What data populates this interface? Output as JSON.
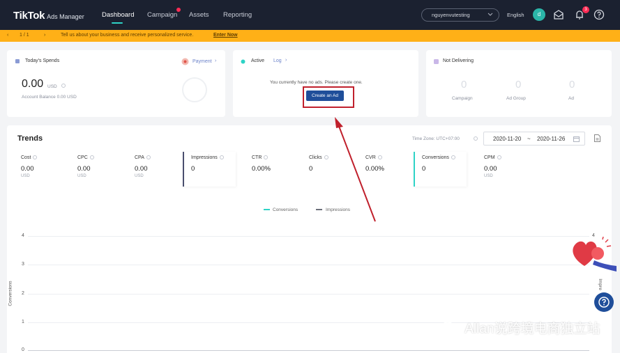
{
  "nav": {
    "logo": "TikTok",
    "logo_suffix": "Ads Manager",
    "items": [
      "Dashboard",
      "Campaign",
      "Assets",
      "Reporting"
    ],
    "account": "nguyenvutesting",
    "language": "English",
    "avatar_letter": "d",
    "notification_count": "3"
  },
  "banner": {
    "pager": "1 / 1",
    "text": "Tell us about your business and receive personalized service.",
    "link": "Enter Now"
  },
  "spends": {
    "title": "Today's Spends",
    "payment_label": "Payment",
    "amount": "0.00",
    "currency": "USD",
    "balance": "Account Balance 0.00 USD"
  },
  "active": {
    "title": "Active",
    "log_label": "Log",
    "message": "You currently have no ads. Please create one.",
    "create_button": "Create an Ad"
  },
  "not_delivering": {
    "title": "Not Delivering",
    "items": [
      {
        "value": "0",
        "label": "Campaign"
      },
      {
        "value": "0",
        "label": "Ad Group"
      },
      {
        "value": "0",
        "label": "Ad"
      }
    ]
  },
  "trends": {
    "title": "Trends",
    "timezone": "Time Zone: UTC+07:00",
    "date_start": "2020-11-20",
    "date_sep": "~",
    "date_end": "2020-11-26",
    "metrics": [
      {
        "label": "Cost",
        "value": "0.00",
        "unit": "USD"
      },
      {
        "label": "CPC",
        "value": "0.00",
        "unit": "USD"
      },
      {
        "label": "CPA",
        "value": "0.00",
        "unit": "USD"
      },
      {
        "label": "Impressions",
        "value": "0",
        "unit": ""
      },
      {
        "label": "CTR",
        "value": "0.00%",
        "unit": ""
      },
      {
        "label": "Clicks",
        "value": "0",
        "unit": ""
      },
      {
        "label": "CVR",
        "value": "0.00%",
        "unit": ""
      },
      {
        "label": "Conversions",
        "value": "0",
        "unit": ""
      },
      {
        "label": "CPM",
        "value": "0.00",
        "unit": "USD"
      }
    ],
    "legend": [
      "Conversions",
      "Impressions"
    ],
    "colors": {
      "conversions": "#2ed3c6",
      "impressions": "#6b6f7a"
    },
    "y_ticks": [
      "4",
      "3",
      "2",
      "1",
      "0"
    ],
    "y_label_left": "Conversions",
    "y_label_right": "Impre",
    "right_tick": "4"
  },
  "watermark": "Allan说跨境电商独立站"
}
